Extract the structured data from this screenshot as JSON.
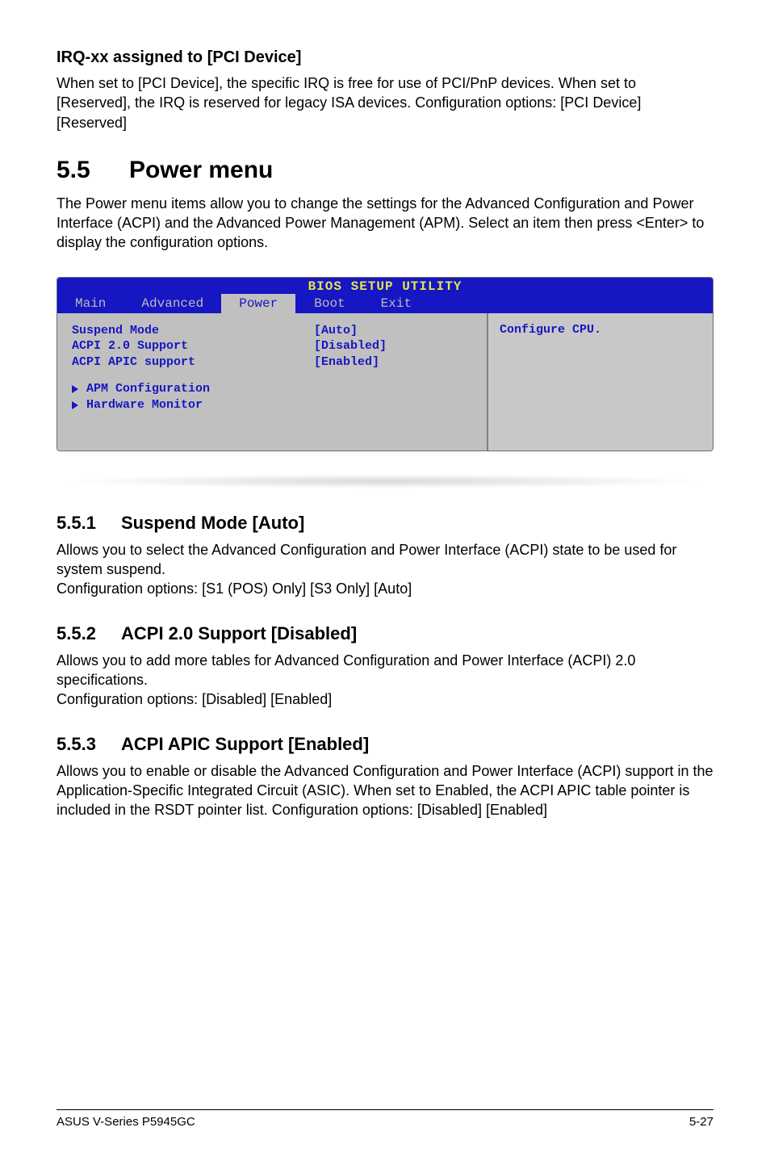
{
  "section_irq": {
    "title": "IRQ-xx assigned to [PCI Device]",
    "body": "When set to [PCI Device], the specific IRQ is free for use of PCI/PnP devices. When set to [Reserved], the IRQ is reserved for legacy ISA devices. Configuration options: [PCI Device] [Reserved]"
  },
  "power_menu": {
    "number": "5.5",
    "title": "Power menu",
    "intro": "The Power menu items allow you to change the settings for the Advanced Configuration and Power Interface (ACPI) and the Advanced Power Management (APM). Select an item then press <Enter> to display the configuration options."
  },
  "bios": {
    "utility_title": "BIOS SETUP UTILITY",
    "tabs": [
      "Main",
      "Advanced",
      "Power",
      "Boot",
      "Exit"
    ],
    "active_tab_index": 2,
    "settings": [
      {
        "label": "Suspend Mode",
        "value": "[Auto]"
      },
      {
        "label": "ACPI 2.0 Support",
        "value": "[Disabled]"
      },
      {
        "label": "ACPI APIC support",
        "value": "[Enabled]"
      }
    ],
    "submenus": [
      "APM Configuration",
      "Hardware Monitor"
    ],
    "help_text": "Configure CPU."
  },
  "subs": {
    "s1": {
      "num": "5.5.1",
      "title": "Suspend Mode [Auto]",
      "p1": "Allows you to select the Advanced Configuration and Power Interface (ACPI) state to be used for system suspend.",
      "p2": "Configuration options: [S1 (POS) Only] [S3 Only] [Auto]"
    },
    "s2": {
      "num": "5.5.2",
      "title": "ACPI 2.0 Support [Disabled]",
      "p1": "Allows you to add more tables for Advanced Configuration and Power Interface (ACPI) 2.0 specifications.",
      "p2": "Configuration options: [Disabled] [Enabled]"
    },
    "s3": {
      "num": "5.5.3",
      "title": "ACPI APIC Support [Enabled]",
      "p1": "Allows you to enable or disable the Advanced Configuration and Power Interface (ACPI) support in the Application-Specific Integrated Circuit (ASIC). When set to Enabled, the ACPI APIC table pointer is included in the RSDT pointer list. Configuration options: [Disabled] [Enabled]"
    }
  },
  "footer": {
    "left": "ASUS V-Series P5945GC",
    "right": "5-27"
  }
}
